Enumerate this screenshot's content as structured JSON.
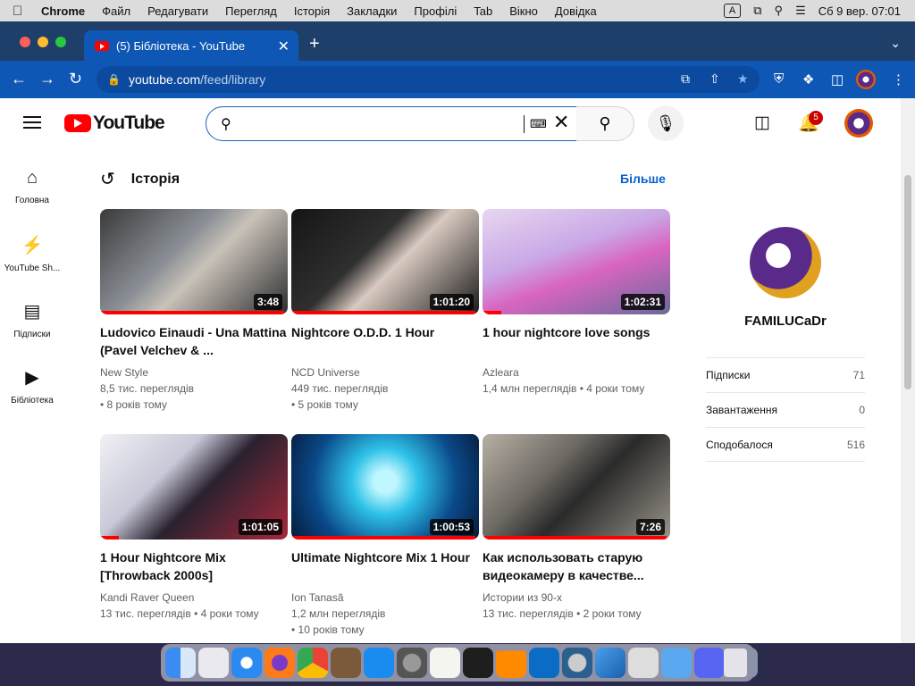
{
  "menubar": {
    "app": "Chrome",
    "items": [
      "Файл",
      "Редагувати",
      "Перегляд",
      "Історія",
      "Закладки",
      "Профілі",
      "Tab",
      "Вікно",
      "Довідка"
    ],
    "input_indicator": "A",
    "datetime": "Сб 9 вер.  07:01"
  },
  "browser": {
    "tab_title": "(5) Бібліотека - YouTube",
    "url_domain": "youtube.com",
    "url_path": "/feed/library"
  },
  "header": {
    "logo_text": "YouTube",
    "search_value": "",
    "notification_count": "5"
  },
  "sidebar": {
    "items": [
      {
        "label": "Головна",
        "icon": "home-icon"
      },
      {
        "label": "YouTube Sh...",
        "icon": "shorts-icon"
      },
      {
        "label": "Підписки",
        "icon": "subscriptions-icon"
      },
      {
        "label": "Бібліотека",
        "icon": "library-icon"
      }
    ]
  },
  "history": {
    "title": "Історія",
    "more_label": "Більше",
    "videos": [
      {
        "title": "Ludovico Einaudi - Una Mattina (Pavel Velchev & ...",
        "channel": "New Style",
        "views": "8,5 тис. переглядів",
        "age": "• 8 років тому",
        "duration": "3:48",
        "watched": 0.98
      },
      {
        "title": "Nightcore O.D.D. 1 Hour",
        "channel": "NCD Universe",
        "views": "449 тис. переглядів",
        "age": "• 5 років тому",
        "duration": "1:01:20",
        "watched": 0.98
      },
      {
        "title": "1 hour nightcore love songs",
        "channel": "Azleara",
        "views": "1,4 млн переглядів",
        "age": "• 4 роки тому",
        "duration": "1:02:31",
        "watched": 0.1
      },
      {
        "title": "1 Hour Nightcore Mix [Throwback 2000s]",
        "channel": "Kandi Raver Queen",
        "views": "13 тис. переглядів",
        "age": "• 4 роки тому",
        "duration": "1:01:05",
        "watched": 0.1
      },
      {
        "title": "Ultimate Nightcore Mix 1 Hour",
        "channel": "Ion Tanasă",
        "views": "1,2 млн переглядів",
        "age": "• 10 років тому",
        "duration": "1:00:53",
        "watched": 0.98
      },
      {
        "title": "Как использовать старую видеокамеру в качестве...",
        "channel": "Истории из 90-х",
        "views": "13 тис. переглядів",
        "age": "• 2 роки тому",
        "duration": "7:26",
        "watched": 0.98
      }
    ]
  },
  "profile": {
    "name": "FAMILUCaDr",
    "stats": [
      {
        "label": "Підписки",
        "value": "71"
      },
      {
        "label": "Завантаження",
        "value": "0"
      },
      {
        "label": "Сподобалося",
        "value": "516"
      }
    ]
  },
  "colors": {
    "accent": "#065fd4",
    "brand_red": "#ff0000",
    "browser_blue": "#0f57b5",
    "tabstrip": "#1f3f6b"
  }
}
